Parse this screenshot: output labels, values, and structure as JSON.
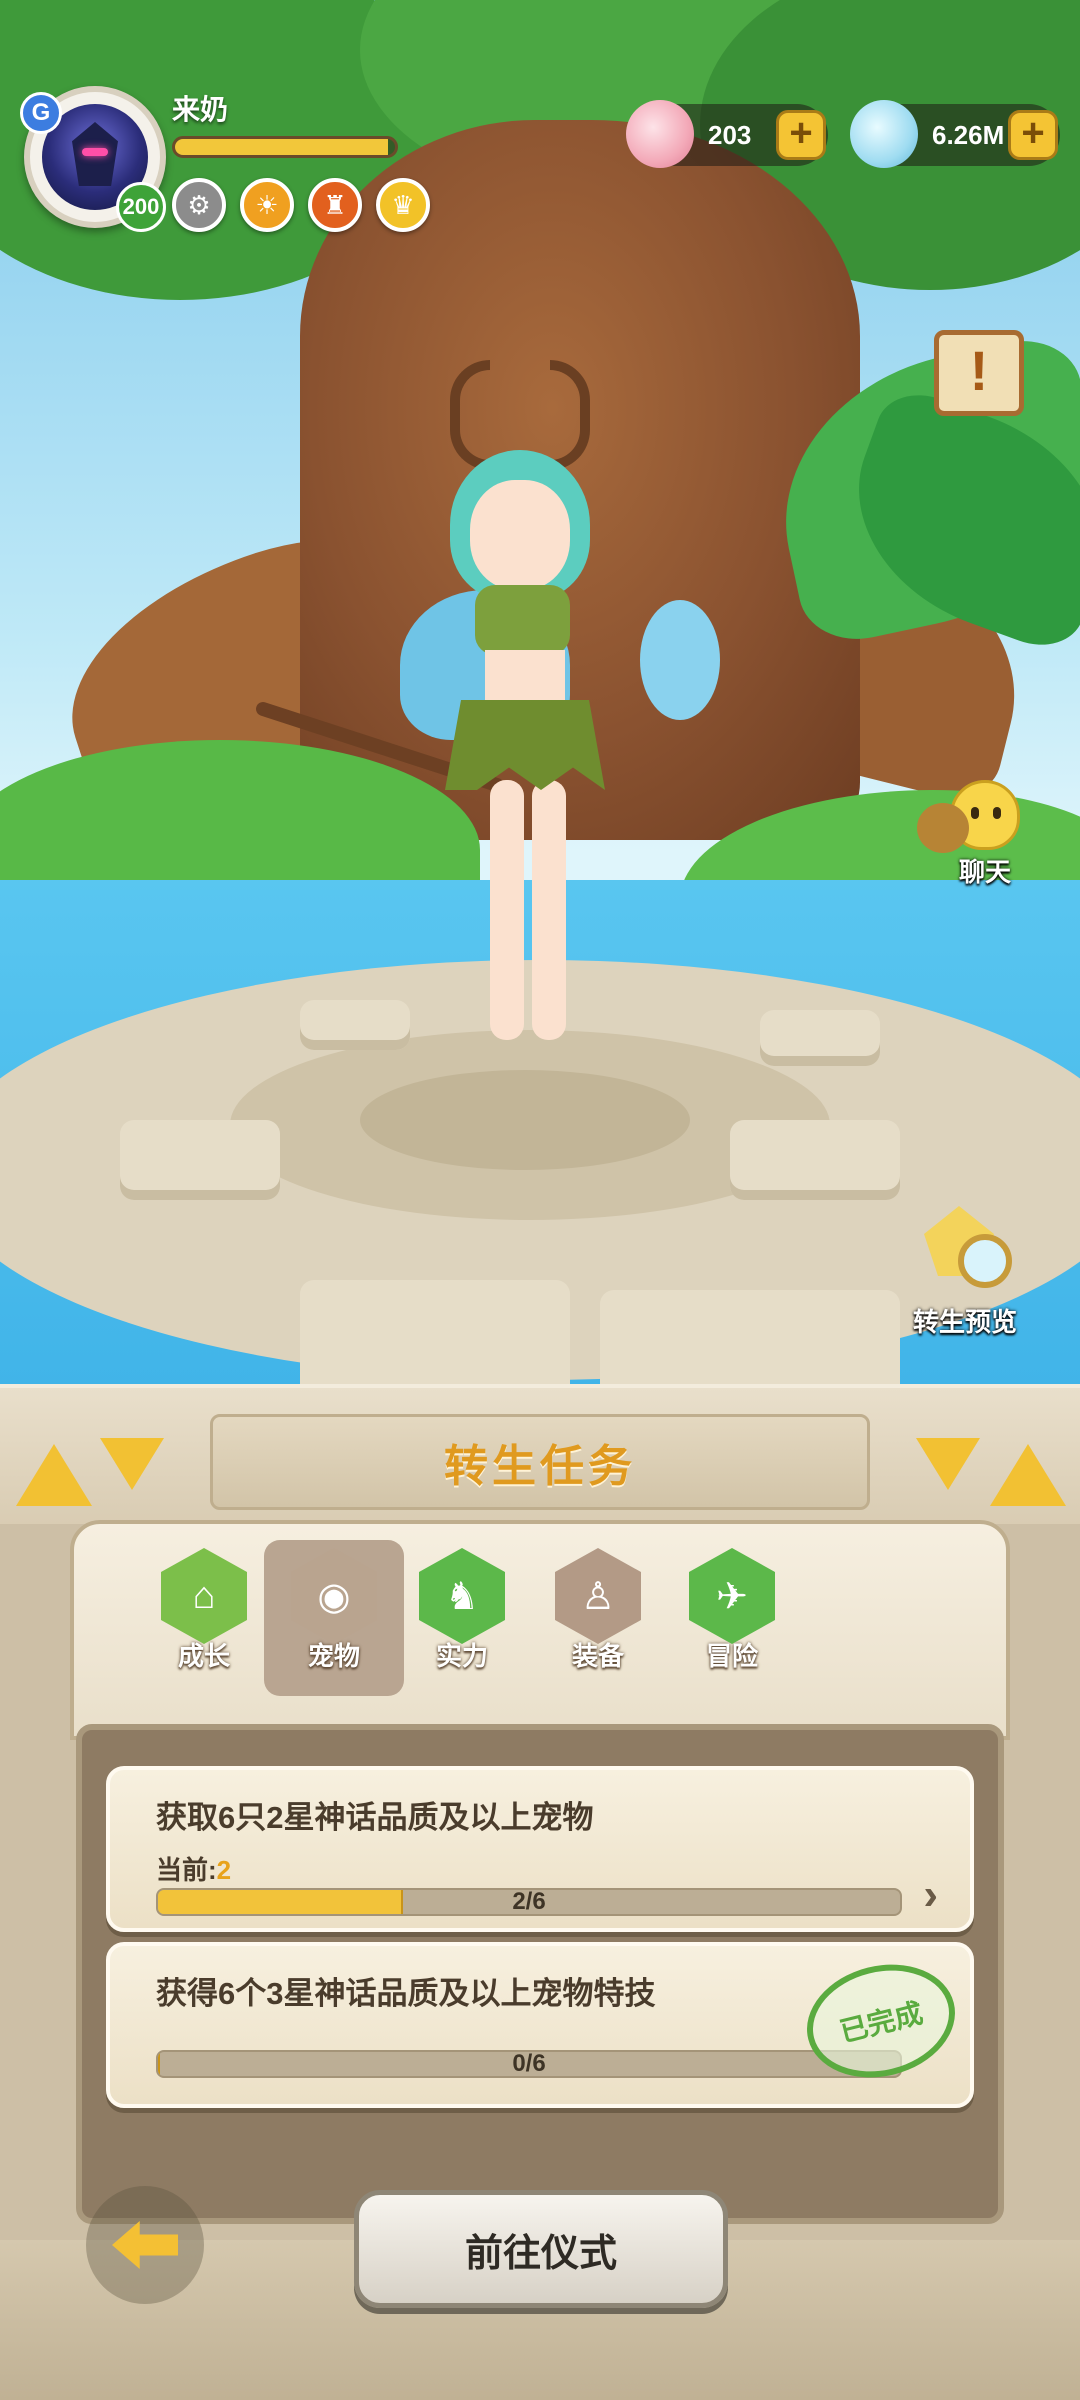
{
  "player": {
    "name": "来奶",
    "level": "200",
    "vip": "G",
    "exp_fraction": 0.97,
    "badges": [
      {
        "icon": "gear-badge-icon",
        "color": "#8c8c8c",
        "glyph": "⚙"
      },
      {
        "icon": "beast-badge-icon",
        "color": "#f0a020",
        "glyph": "☀"
      },
      {
        "icon": "lion-badge-icon",
        "color": "#e2601e",
        "glyph": "♜"
      },
      {
        "icon": "crown-badge-icon",
        "color": "#f2c228",
        "glyph": "♛"
      }
    ]
  },
  "currencies": {
    "shell": {
      "value": "203",
      "icon": "shell-currency-icon"
    },
    "gem": {
      "value": "6.26M",
      "icon": "gem-currency-icon"
    },
    "plus_label": "+"
  },
  "quest_icon_label": "!",
  "side_buttons": {
    "chat": {
      "label": "聊天"
    },
    "rebirth_preview": {
      "label": "转生预览"
    }
  },
  "panel": {
    "title": "转生任务",
    "tabs": [
      {
        "label": "成长",
        "icon": "growth-icon",
        "color": "#7cbf4a",
        "active": false,
        "glyph": "⌂"
      },
      {
        "label": "宠物",
        "icon": "pet-icon",
        "color": "#b9a48f",
        "active": true,
        "glyph": "◉"
      },
      {
        "label": "实力",
        "icon": "strength-icon",
        "color": "#5cb84a",
        "active": false,
        "glyph": "♞"
      },
      {
        "label": "装备",
        "icon": "equipment-icon",
        "color": "#b39a86",
        "active": false,
        "glyph": "♙"
      },
      {
        "label": "冒险",
        "icon": "adventure-icon",
        "color": "#5cb84a",
        "active": false,
        "glyph": "✈"
      }
    ],
    "tasks": [
      {
        "title": "获取6只2星神话品质及以上宠物",
        "current_label": "当前:",
        "current_value": "2",
        "progress_text": "2/6",
        "progress": 0.33,
        "completed": false
      },
      {
        "title": "获得6个3星神话品质及以上宠物特技",
        "progress_text": "0/6",
        "progress": 0,
        "completed": true,
        "stamp_label": "已完成"
      }
    ],
    "go_button": "前往仪式",
    "chevron": "›"
  }
}
